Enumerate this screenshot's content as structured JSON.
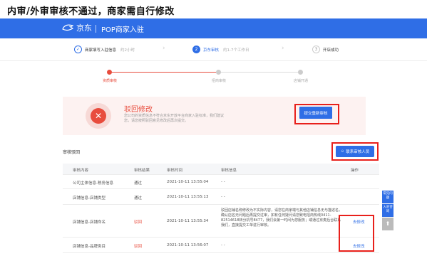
{
  "caption": "内审/外审审核不通过，商家需自行修改",
  "header": {
    "logo_text": "京东",
    "title": "POP商家入驻"
  },
  "steps": [
    {
      "label": "商家填写入驻信息",
      "sub": "约2小时",
      "state": "done",
      "mark": "✓"
    },
    {
      "label": "京东审核",
      "sub": "约1-7个工作日",
      "state": "active",
      "mark": "2"
    },
    {
      "label": "开店成功",
      "sub": "",
      "state": "todo",
      "mark": "3"
    }
  ],
  "progress": [
    {
      "label": "资质审核",
      "state": "active"
    },
    {
      "label": "招商审核",
      "state": "todo"
    },
    {
      "label": "店铺开通",
      "state": "todo"
    }
  ],
  "reject": {
    "mark": "✕",
    "title": "驳回修改",
    "desc": "您公司的资质信息不符合京东开放平台商家入驻标准，我们建议您，请您按照驳回意见修改后再次提交。",
    "button": "提交重新审核"
  },
  "section_title": "审核驳回",
  "contact_button": "联系审核人员",
  "table": {
    "headers": [
      "审核内容",
      "审核结果",
      "审核时间",
      "审核信息",
      "操作"
    ],
    "rows": [
      {
        "content": "公司主体信息-税务信息",
        "result": "通过",
        "time": "2021-10-11 13:55:04",
        "info": "- -",
        "action": ""
      },
      {
        "content": "店铺信息-店铺类型",
        "result": "通过",
        "time": "2021-10-11 13:55:13",
        "info": "- -",
        "action": ""
      },
      {
        "content": "店铺信息-店铺命名",
        "result": "驳回",
        "time": "2021-10-11 13:55:34",
        "info": "驳回店铺名称修改为不实际内容，请您在商家端与其他店铺信息无与描述名，确认店名无问题后再提交过审，如有任何疑问请您致电招商热线0411-82514618转分机号8477，我们会第一时间为您服务；或通过京麦后台联系我们，直接提交工单进行审核。",
        "action": "去修改"
      },
      {
        "content": "店铺信息-品牌类目",
        "result": "驳回",
        "time": "2021-10-11 13:56:07",
        "info": "- -",
        "action": "去修改"
      }
    ]
  },
  "float_bar": [
    {
      "label": "常见问题",
      "kind": "blue"
    },
    {
      "label": "入驻咨询",
      "kind": "blue"
    },
    {
      "label": "⬆",
      "kind": "grey"
    }
  ]
}
